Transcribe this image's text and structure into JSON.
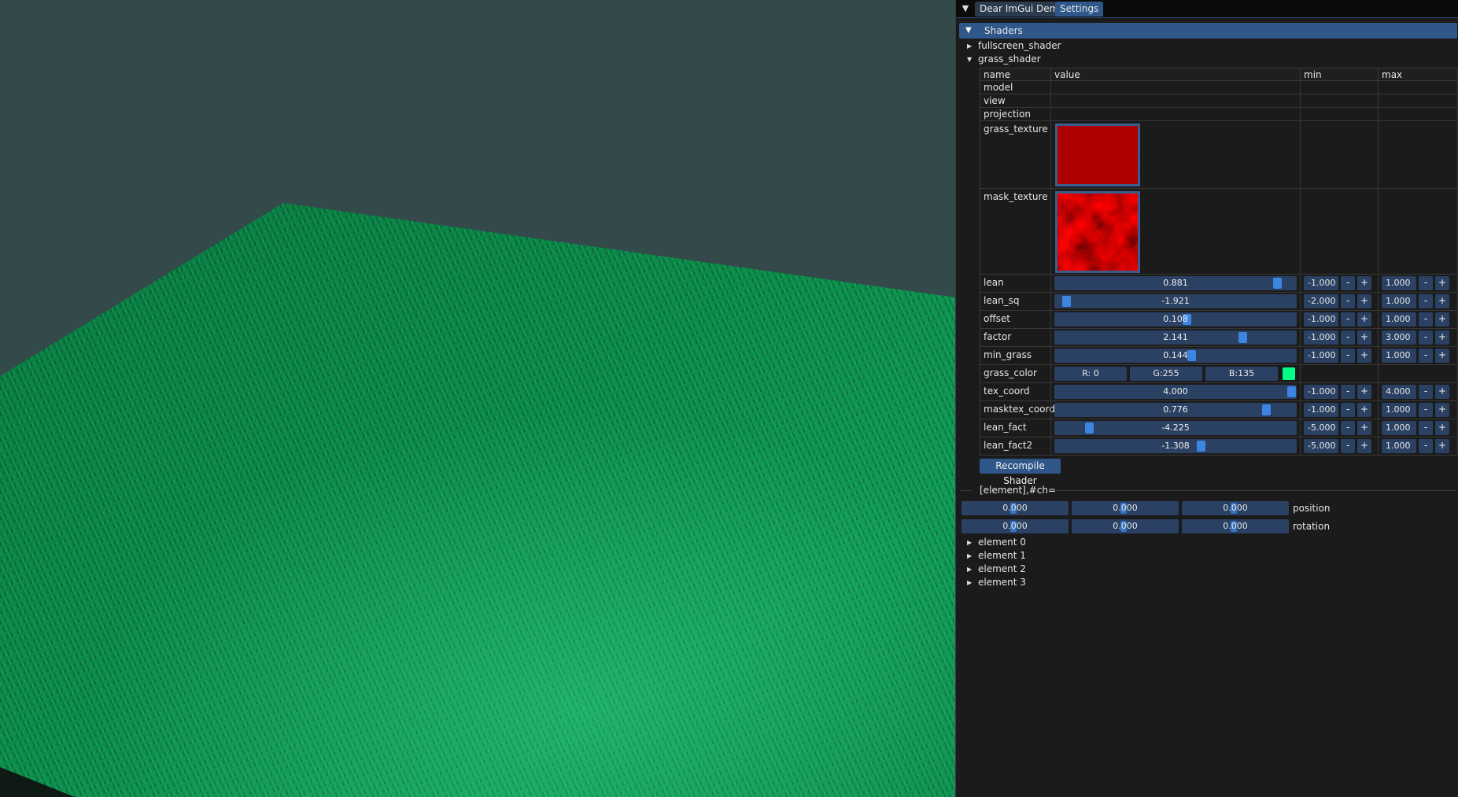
{
  "tabs": [
    {
      "label": "Dear ImGui Demo",
      "active": false
    },
    {
      "label": "Settings",
      "active": true
    }
  ],
  "shaders_header": {
    "label": "Shaders",
    "expanded": true
  },
  "shader_nodes": [
    {
      "label": "fullscreen_shader",
      "expanded": false
    },
    {
      "label": "grass_shader",
      "expanded": true
    }
  ],
  "table": {
    "columns": [
      "name",
      "value",
      "min",
      "max"
    ],
    "matrix_rows": [
      "model",
      "view",
      "projection"
    ],
    "textures": [
      {
        "name": "grass_texture",
        "tint": "#8e0000"
      },
      {
        "name": "mask_texture",
        "tint": "#b50000"
      }
    ],
    "params": [
      {
        "name": "lean",
        "value": "0.881",
        "pos": 0.94,
        "min": "-1.000",
        "max": "1.000"
      },
      {
        "name": "lean_sq",
        "value": "-1.921",
        "pos": 0.03,
        "min": "-2.000",
        "max": "1.000"
      },
      {
        "name": "offset",
        "value": "0.108",
        "pos": 0.55,
        "min": "-1.000",
        "max": "1.000"
      },
      {
        "name": "factor",
        "value": "2.141",
        "pos": 0.79,
        "min": "-1.000",
        "max": "3.000"
      },
      {
        "name": "min_grass",
        "value": "0.144",
        "pos": 0.57,
        "min": "-1.000",
        "max": "1.000"
      }
    ],
    "grass_color": {
      "name": "grass_color",
      "r": "R:  0",
      "g": "G:255",
      "b": "B:135",
      "swatch": "#00ff87"
    },
    "params2": [
      {
        "name": "tex_coord",
        "value": "4.000",
        "pos": 1.0,
        "min": "-1.000",
        "max": "4.000"
      },
      {
        "name": "masktex_coord",
        "value": "0.776",
        "pos": 0.89,
        "min": "-1.000",
        "max": "1.000"
      },
      {
        "name": "lean_fact",
        "value": "-4.225",
        "pos": 0.13,
        "min": "-5.000",
        "max": "1.000"
      },
      {
        "name": "lean_fact2",
        "value": "-1.308",
        "pos": 0.61,
        "min": "-5.000",
        "max": "1.000"
      }
    ],
    "minus": "-",
    "plus": "+"
  },
  "recompile_label": "Recompile Shader",
  "element_separator_label": "[element],#ch=",
  "transform": {
    "position": {
      "label": "position",
      "values": [
        "0.000",
        "0.000",
        "0.000"
      ]
    },
    "rotation": {
      "label": "rotation",
      "values": [
        "0.000",
        "0.000",
        "0.000"
      ]
    }
  },
  "elements": [
    "element 0",
    "element 1",
    "element 2",
    "element 3"
  ],
  "colors": {
    "accent": "#2f5789",
    "frame": "#2b4163",
    "grab": "#3d85e0",
    "sky": "#33494a",
    "grass": "#0c8c4a"
  }
}
